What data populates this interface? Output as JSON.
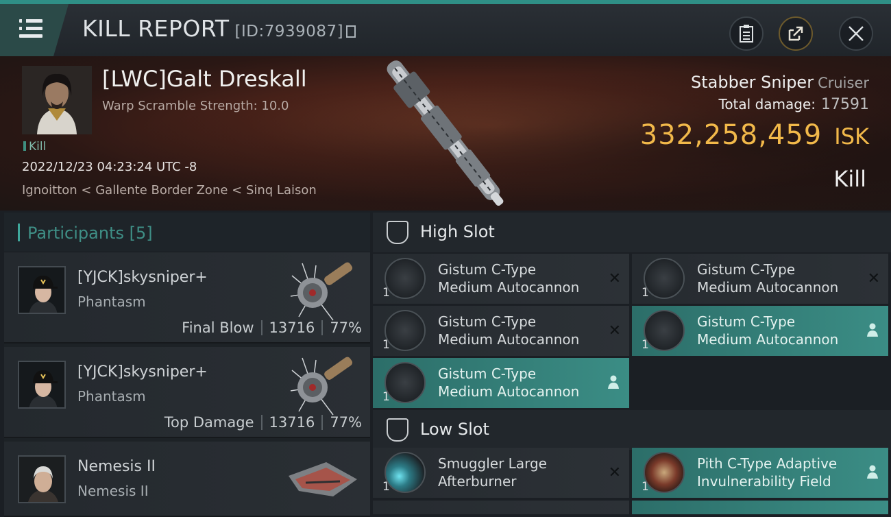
{
  "header": {
    "title": "KILL REPORT",
    "id_label": "[ID:7939087]",
    "icons": [
      "menu-icon",
      "clipboard-icon",
      "share-icon",
      "close-icon"
    ]
  },
  "victim": {
    "name": "[LWC]Galt Dreskall",
    "sub": "Warp Scramble Strength: 10.0",
    "tag": "Kill",
    "date": "2022/12/23 04:23:24 UTC -8",
    "location": "Ignoitton < Gallente Border Zone < Sinq Laison",
    "ship_name": "Stabber Sniper",
    "ship_class": "Cruiser",
    "total_damage_label": "Total damage:",
    "total_damage": "17591",
    "isk_value": "332,258,459",
    "isk_unit": "ISK",
    "result": "Kill"
  },
  "participants": {
    "label": "Participants",
    "count": "[5]",
    "rows": [
      {
        "name": "[YJCK]skysniper+",
        "ship": "Phantasm",
        "role": "Final Blow",
        "damage": "13716",
        "percent": "77%"
      },
      {
        "name": "[YJCK]skysniper+",
        "ship": "Phantasm",
        "role": "Top Damage",
        "damage": "13716",
        "percent": "77%"
      },
      {
        "name": "Nemesis II",
        "ship": "Nemesis II",
        "role": "",
        "damage": "",
        "percent": ""
      }
    ]
  },
  "fitting": {
    "high_slot_label": "High Slot",
    "low_slot_label": "Low Slot",
    "high": [
      {
        "line1": "Gistum C-Type",
        "line2": "Medium Autocannon",
        "qty": "1",
        "status": "destroyed"
      },
      {
        "line1": "Gistum C-Type",
        "line2": "Medium Autocannon",
        "qty": "1",
        "status": "destroyed"
      },
      {
        "line1": "Gistum C-Type",
        "line2": "Medium Autocannon",
        "qty": "1",
        "status": "destroyed"
      },
      {
        "line1": "Gistum C-Type",
        "line2": "Medium Autocannon",
        "qty": "1",
        "status": "dropped"
      },
      {
        "line1": "Gistum C-Type",
        "line2": "Medium Autocannon",
        "qty": "1",
        "status": "dropped"
      }
    ],
    "low": [
      {
        "line1": "Smuggler Large",
        "line2": "Afterburner",
        "qty": "1",
        "status": "destroyed"
      },
      {
        "line1": "Pith C-Type Adaptive",
        "line2": "Invulnerability Field",
        "qty": "1",
        "status": "dropped"
      }
    ]
  },
  "colors": {
    "accent": "#3f8f86",
    "isk": "#f2b94a",
    "dropped_bg": "#3b8d85"
  }
}
